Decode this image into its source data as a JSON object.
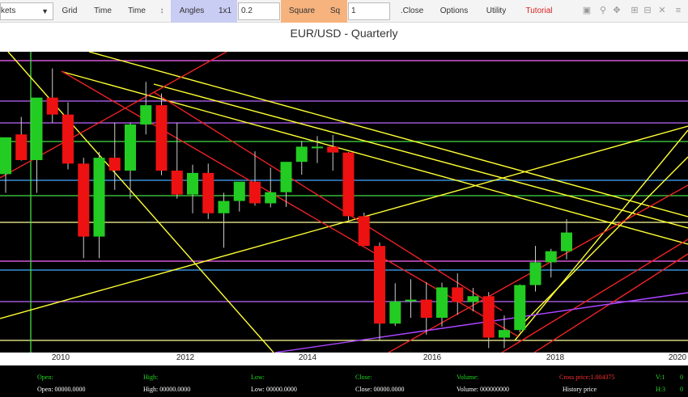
{
  "toolbar": {
    "market_select": "kets",
    "grid": "Grid",
    "time1": "Time",
    "time2": "Time",
    "angles": "Angles",
    "ratio": "1x1",
    "angle_value": "0.2",
    "square": "Square",
    "sq": "Sq",
    "sq_value": "1",
    "close": ".Close",
    "options": "Options",
    "utility": "Utility",
    "tutorial": "Tutorial"
  },
  "icons": [
    "sort-icon",
    "save-icon",
    "zoom-icon",
    "pan-icon",
    "zoom-in-icon",
    "zoom-out-icon",
    "reset-icon",
    "menu-icon"
  ],
  "chart": {
    "title": "EUR/USD - Quarterly",
    "x_labels": [
      "2010",
      "2012",
      "2014",
      "2016",
      "2018",
      "2020"
    ]
  },
  "info": {
    "open_label": "Open:",
    "high_label": "High:",
    "low_label": "Low:",
    "close_label": "Close:",
    "volume_label": "Volume:",
    "open_value": "Open: 00000.0000",
    "high_value": "High: 00000.0000",
    "low_value": "Low: 00000.0000",
    "close_value": "Close: 00000.0000",
    "volume_value": "Volume: 000000000",
    "cross_price": "Cross price:1.004375",
    "history_price": "History price",
    "v1": "V:1",
    "h3": "H:3",
    "right1": "0",
    "right2": "0"
  },
  "colors": {
    "up": "#22cc22",
    "down": "#ee1111",
    "background": "#000000"
  },
  "chart_data": {
    "type": "candlestick",
    "title": "EUR/USD - Quarterly",
    "x_ticks": [
      "2010",
      "2012",
      "2014",
      "2016",
      "2018",
      "2020"
    ],
    "candles": [
      {
        "t": 2009.0,
        "o": 1.332,
        "h": 1.395,
        "l": 1.3,
        "c": 1.395
      },
      {
        "t": 2009.25,
        "o": 1.4,
        "h": 1.43,
        "l": 1.355,
        "c": 1.356
      },
      {
        "t": 2009.5,
        "o": 1.356,
        "h": 1.41,
        "l": 1.3,
        "c": 1.463
      },
      {
        "t": 2009.75,
        "o": 1.463,
        "h": 1.513,
        "l": 1.42,
        "c": 1.434
      },
      {
        "t": 2010.0,
        "o": 1.434,
        "h": 1.455,
        "l": 1.34,
        "c": 1.35
      },
      {
        "t": 2010.25,
        "o": 1.35,
        "h": 1.36,
        "l": 1.188,
        "c": 1.225
      },
      {
        "t": 2010.5,
        "o": 1.225,
        "h": 1.37,
        "l": 1.188,
        "c": 1.36
      },
      {
        "t": 2010.75,
        "o": 1.36,
        "h": 1.42,
        "l": 1.305,
        "c": 1.338
      },
      {
        "t": 2011.0,
        "o": 1.338,
        "h": 1.42,
        "l": 1.29,
        "c": 1.417
      },
      {
        "t": 2011.25,
        "o": 1.417,
        "h": 1.49,
        "l": 1.4,
        "c": 1.45
      },
      {
        "t": 2011.5,
        "o": 1.45,
        "h": 1.47,
        "l": 1.33,
        "c": 1.338
      },
      {
        "t": 2011.75,
        "o": 1.338,
        "h": 1.42,
        "l": 1.29,
        "c": 1.297
      },
      {
        "t": 2012.0,
        "o": 1.297,
        "h": 1.348,
        "l": 1.265,
        "c": 1.334
      },
      {
        "t": 2012.25,
        "o": 1.334,
        "h": 1.35,
        "l": 1.255,
        "c": 1.265
      },
      {
        "t": 2012.5,
        "o": 1.265,
        "h": 1.3,
        "l": 1.206,
        "c": 1.286
      },
      {
        "t": 2012.75,
        "o": 1.286,
        "h": 1.315,
        "l": 1.268,
        "c": 1.319
      },
      {
        "t": 2013.0,
        "o": 1.319,
        "h": 1.371,
        "l": 1.278,
        "c": 1.282
      },
      {
        "t": 2013.25,
        "o": 1.282,
        "h": 1.343,
        "l": 1.275,
        "c": 1.301
      },
      {
        "t": 2013.5,
        "o": 1.301,
        "h": 1.35,
        "l": 1.276,
        "c": 1.353
      },
      {
        "t": 2013.75,
        "o": 1.353,
        "h": 1.389,
        "l": 1.331,
        "c": 1.379
      },
      {
        "t": 2014.0,
        "o": 1.379,
        "h": 1.397,
        "l": 1.351,
        "c": 1.379
      },
      {
        "t": 2014.25,
        "o": 1.379,
        "h": 1.399,
        "l": 1.338,
        "c": 1.369
      },
      {
        "t": 2014.5,
        "o": 1.369,
        "h": 1.37,
        "l": 1.253,
        "c": 1.26
      },
      {
        "t": 2014.75,
        "o": 1.26,
        "h": 1.266,
        "l": 1.235,
        "c": 1.209
      },
      {
        "t": 2015.0,
        "o": 1.209,
        "h": 1.215,
        "l": 1.046,
        "c": 1.076
      },
      {
        "t": 2015.25,
        "o": 1.076,
        "h": 1.145,
        "l": 1.072,
        "c": 1.114
      },
      {
        "t": 2015.5,
        "o": 1.114,
        "h": 1.152,
        "l": 1.086,
        "c": 1.117
      },
      {
        "t": 2015.75,
        "o": 1.117,
        "h": 1.147,
        "l": 1.057,
        "c": 1.086
      },
      {
        "t": 2016.0,
        "o": 1.086,
        "h": 1.146,
        "l": 1.071,
        "c": 1.138
      },
      {
        "t": 2016.25,
        "o": 1.138,
        "h": 1.162,
        "l": 1.091,
        "c": 1.113
      },
      {
        "t": 2016.5,
        "o": 1.113,
        "h": 1.137,
        "l": 1.097,
        "c": 1.123
      },
      {
        "t": 2016.75,
        "o": 1.123,
        "h": 1.13,
        "l": 1.034,
        "c": 1.052
      },
      {
        "t": 2017.0,
        "o": 1.052,
        "h": 1.09,
        "l": 1.034,
        "c": 1.065
      },
      {
        "t": 2017.25,
        "o": 1.065,
        "h": 1.143,
        "l": 1.061,
        "c": 1.142
      },
      {
        "t": 2017.5,
        "o": 1.142,
        "h": 1.209,
        "l": 1.131,
        "c": 1.181
      },
      {
        "t": 2017.75,
        "o": 1.181,
        "h": 1.204,
        "l": 1.155,
        "c": 1.2
      },
      {
        "t": 2018.0,
        "o": 1.2,
        "h": 1.255,
        "l": 1.186,
        "c": 1.232
      }
    ]
  }
}
